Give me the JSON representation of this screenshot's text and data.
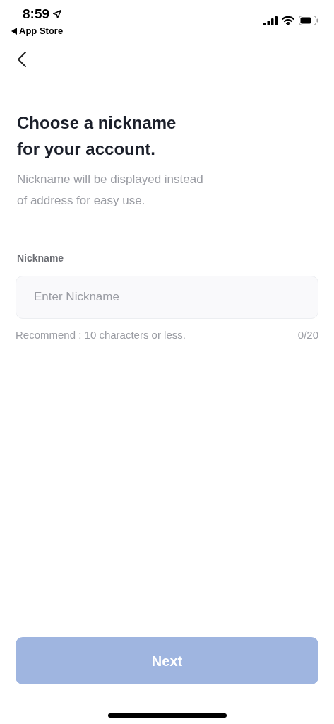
{
  "status_bar": {
    "time": "8:59",
    "back_app": "App Store"
  },
  "heading": {
    "title": "Choose a nickname for your account.",
    "subtitle": "Nickname will be displayed instead of address for easy use."
  },
  "nickname_field": {
    "label": "Nickname",
    "placeholder": "Enter Nickname",
    "hint": "Recommend : 10 characters or less.",
    "counter": "0/20"
  },
  "next_button": {
    "label": "Next",
    "disabled": true
  }
}
